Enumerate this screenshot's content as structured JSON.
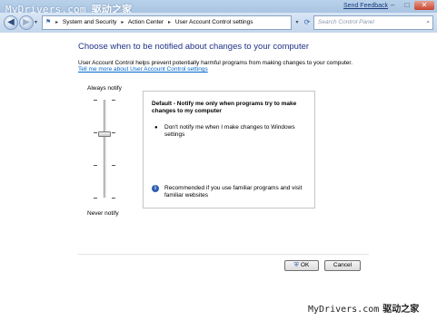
{
  "watermark": {
    "site": "MyDrivers.com",
    "brand": "驱动之家"
  },
  "titlebar": {
    "send_feedback": "Send Feedback",
    "minimize": "–",
    "maximize": "□",
    "close": "✕"
  },
  "nav": {
    "back_glyph": "◀",
    "forward_glyph": "▶",
    "dropdown_glyph": "▾",
    "breadcrumb": [
      "System and Security",
      "Action Center",
      "User Account Control settings"
    ],
    "breadcrumb_sep": "▸",
    "refresh_glyph": "⟳",
    "search_placeholder": "Search Control Panel",
    "search_glyph": "⌕"
  },
  "main": {
    "title": "Choose when to be notified about changes to your computer",
    "description": "User Account Control helps prevent potentially harmful programs from making changes to your computer.",
    "help_link": "Tell me more about User Account Control settings",
    "slider": {
      "top_label": "Always notify",
      "bottom_label": "Never notify",
      "level_index": 2,
      "level_count": 4
    },
    "panel": {
      "heading": "Default - Notify me only when programs try to make changes to my computer",
      "bullet": "Don't notify me when I make changes to Windows settings",
      "recommendation": "Recommended if you use familiar programs and visit familiar websites",
      "info_glyph": "i"
    },
    "buttons": {
      "ok": "OK",
      "cancel": "Cancel"
    }
  },
  "colors": {
    "title_blue": "#1e3287",
    "link_blue": "#0066cc",
    "chrome_blue": "#cdddef"
  },
  "icons": [
    "back-icon",
    "forward-icon",
    "flag-icon",
    "refresh-icon",
    "search-icon",
    "info-icon",
    "shield-icon"
  ]
}
